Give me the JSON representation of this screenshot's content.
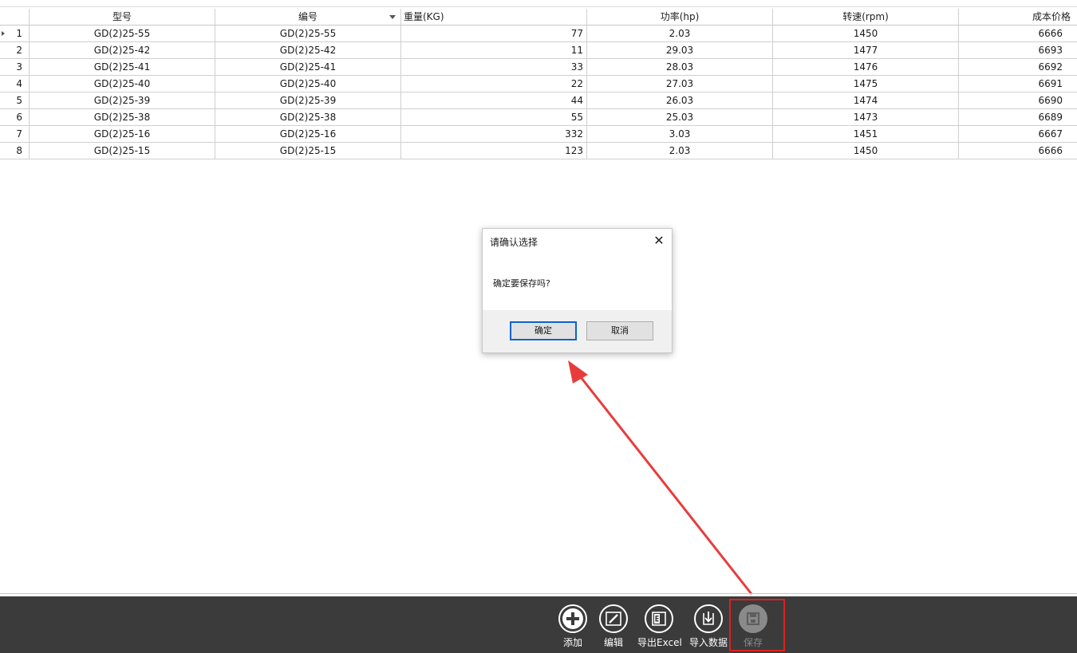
{
  "grid": {
    "columns": [
      "型号",
      "编号",
      "重量(KG)",
      "功率(hp)",
      "转速(rpm)",
      "成本价格"
    ],
    "rows": [
      {
        "index": "1",
        "model": "GD(2)25-55",
        "code": "GD(2)25-55",
        "weight": "77",
        "power": "2.03",
        "speed": "1450",
        "cost": "6666"
      },
      {
        "index": "2",
        "model": "GD(2)25-42",
        "code": "GD(2)25-42",
        "weight": "11",
        "power": "29.03",
        "speed": "1477",
        "cost": "6693"
      },
      {
        "index": "3",
        "model": "GD(2)25-41",
        "code": "GD(2)25-41",
        "weight": "33",
        "power": "28.03",
        "speed": "1476",
        "cost": "6692"
      },
      {
        "index": "4",
        "model": "GD(2)25-40",
        "code": "GD(2)25-40",
        "weight": "22",
        "power": "27.03",
        "speed": "1475",
        "cost": "6691"
      },
      {
        "index": "5",
        "model": "GD(2)25-39",
        "code": "GD(2)25-39",
        "weight": "44",
        "power": "26.03",
        "speed": "1474",
        "cost": "6690"
      },
      {
        "index": "6",
        "model": "GD(2)25-38",
        "code": "GD(2)25-38",
        "weight": "55",
        "power": "25.03",
        "speed": "1473",
        "cost": "6689"
      },
      {
        "index": "7",
        "model": "GD(2)25-16",
        "code": "GD(2)25-16",
        "weight": "332",
        "power": "3.03",
        "speed": "1451",
        "cost": "6667"
      },
      {
        "index": "8",
        "model": "GD(2)25-15",
        "code": "GD(2)25-15",
        "weight": "123",
        "power": "2.03",
        "speed": "1450",
        "cost": "6666"
      }
    ]
  },
  "dialog": {
    "title": "请确认选择",
    "close_glyph": "✕",
    "message": "确定要保存吗?",
    "ok_label": "确定",
    "cancel_label": "取消"
  },
  "toolbar": {
    "add_label": "添加",
    "edit_label": "编辑",
    "export_label": "导出Excel",
    "import_label": "导入数据",
    "save_label": "保存",
    "save_state": "disabled"
  },
  "colors": {
    "toolbar_bg": "#3b3b3b",
    "highlight": "#e02020",
    "annotation_arrow": "#e83c3c",
    "ok_border": "#0a64c8"
  }
}
